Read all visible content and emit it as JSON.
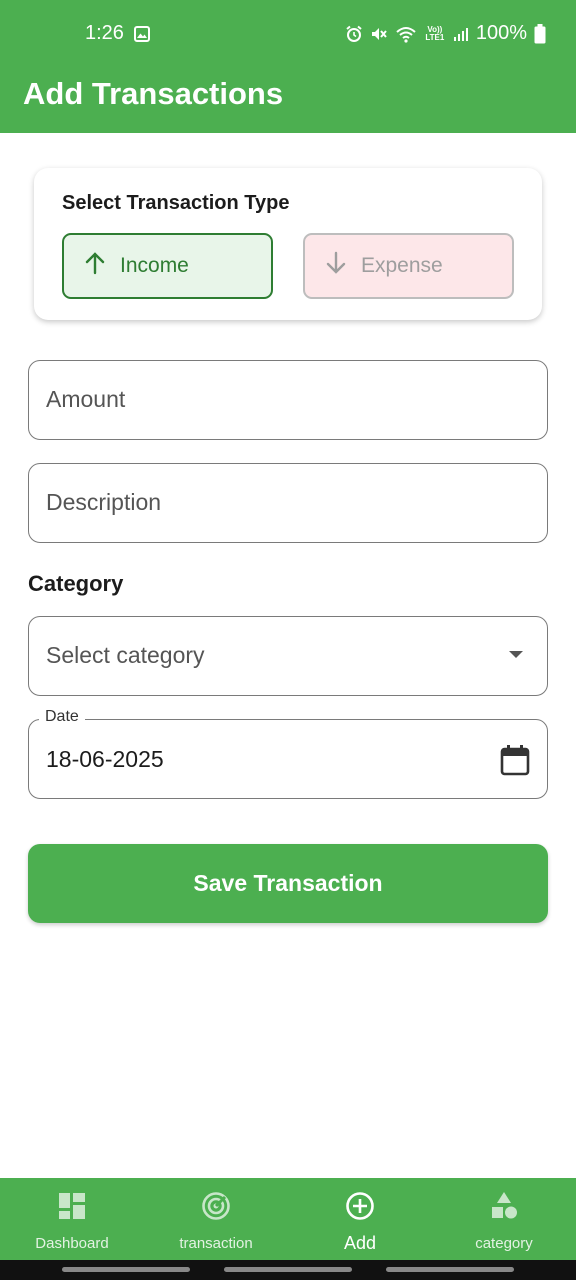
{
  "status_bar": {
    "time": "1:26",
    "battery": "100%",
    "network": "Vo)) LTE1"
  },
  "app_bar": {
    "title": "Add Transactions"
  },
  "transaction_type": {
    "title": "Select Transaction Type",
    "income_label": "Income",
    "expense_label": "Expense",
    "selected": "Income"
  },
  "form": {
    "amount_placeholder": "Amount",
    "description_placeholder": "Description",
    "category_label": "Category",
    "category_placeholder": "Select category",
    "date_label": "Date",
    "date_value": "18-06-2025",
    "save_label": "Save Transaction"
  },
  "bottom_nav": {
    "items": [
      {
        "label": "Dashboard",
        "icon": "dashboard-icon"
      },
      {
        "label": "transaction",
        "icon": "track-changes-icon"
      },
      {
        "label": "Add",
        "icon": "add-circle-icon"
      },
      {
        "label": "category",
        "icon": "category-icon"
      }
    ],
    "active": "Add"
  },
  "colors": {
    "primary": "#4CAF50",
    "income_border": "#2E7D32",
    "income_bg": "#E8F5E9",
    "expense_bg": "#FDE7E9"
  }
}
